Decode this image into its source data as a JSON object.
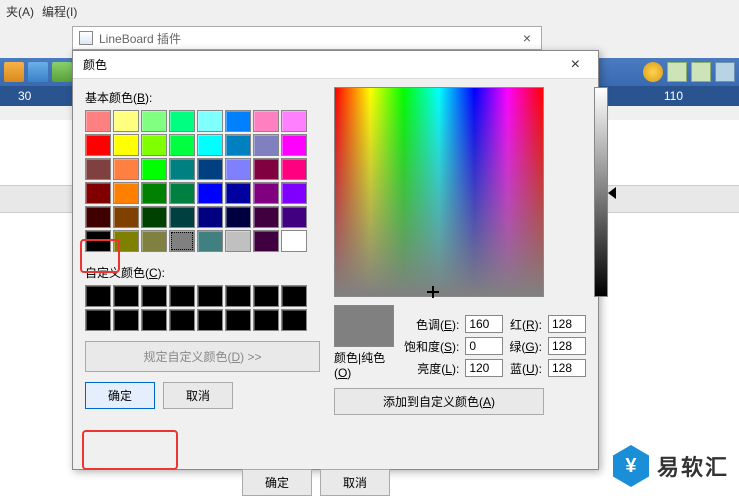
{
  "menu": {
    "items": [
      "夹(A)",
      "编程(I)"
    ]
  },
  "plugin_window": {
    "title": "LineBoard 插件"
  },
  "color_dialog": {
    "title": "颜色",
    "basic_label_pre": "基本颜色(",
    "basic_label_u": "B",
    "basic_label_post": "):",
    "custom_label_pre": "自定义颜色(",
    "custom_label_u": "C",
    "custom_label_post": "):",
    "define_btn_pre": "规定自定义颜色(",
    "define_btn_u": "D",
    "define_btn_post": ") >>",
    "ok_btn": "确定",
    "cancel_btn": "取消",
    "solid_label_pre": "颜色|纯色(",
    "solid_label_u": "O",
    "solid_label_post": ")",
    "hue_label_pre": "色调(",
    "hue_label_u": "E",
    "hue_label_post": "):",
    "sat_label_pre": "饱和度(",
    "sat_label_u": "S",
    "sat_label_post": "):",
    "lum_label_pre": "亮度(",
    "lum_label_u": "L",
    "lum_label_post": "):",
    "red_label_pre": "红(",
    "red_label_u": "R",
    "red_label_post": "):",
    "green_label_pre": "绿(",
    "green_label_u": "G",
    "green_label_post": "):",
    "blue_label_pre": "蓝(",
    "blue_label_u": "U",
    "blue_label_post": "):",
    "add_btn_pre": "添加到自定义颜色(",
    "add_btn_u": "A",
    "add_btn_post": ")",
    "values": {
      "hue": "160",
      "sat": "0",
      "lum": "120",
      "r": "128",
      "g": "128",
      "b": "128"
    },
    "basic_colors": [
      "#ff8080",
      "#ffff80",
      "#80ff80",
      "#00ff80",
      "#80ffff",
      "#0080ff",
      "#ff80c0",
      "#ff80ff",
      "#ff0000",
      "#ffff00",
      "#80ff00",
      "#00ff40",
      "#00ffff",
      "#0080c0",
      "#8080c0",
      "#ff00ff",
      "#804040",
      "#ff8040",
      "#00ff00",
      "#008080",
      "#004080",
      "#8080ff",
      "#800040",
      "#ff0080",
      "#800000",
      "#ff8000",
      "#008000",
      "#008040",
      "#0000ff",
      "#0000a0",
      "#800080",
      "#8000ff",
      "#400000",
      "#804000",
      "#004000",
      "#004040",
      "#000080",
      "#000040",
      "#400040",
      "#400080",
      "#000000",
      "#808000",
      "#808040",
      "#808080",
      "#408080",
      "#c0c0c0",
      "#400040",
      "#ffffff"
    ],
    "custom_colors": [
      "#000000",
      "#000000",
      "#000000",
      "#000000",
      "#000000",
      "#000000",
      "#000000",
      "#000000",
      "#000000",
      "#000000",
      "#000000",
      "#000000",
      "#000000",
      "#000000",
      "#000000",
      "#000000"
    ]
  },
  "ruler": {
    "ticks": [
      "30",
      "110"
    ]
  },
  "outer_buttons": {
    "ok": "确定",
    "cancel": "取消"
  },
  "brand": {
    "glyph": "¥",
    "text": "易软汇"
  }
}
